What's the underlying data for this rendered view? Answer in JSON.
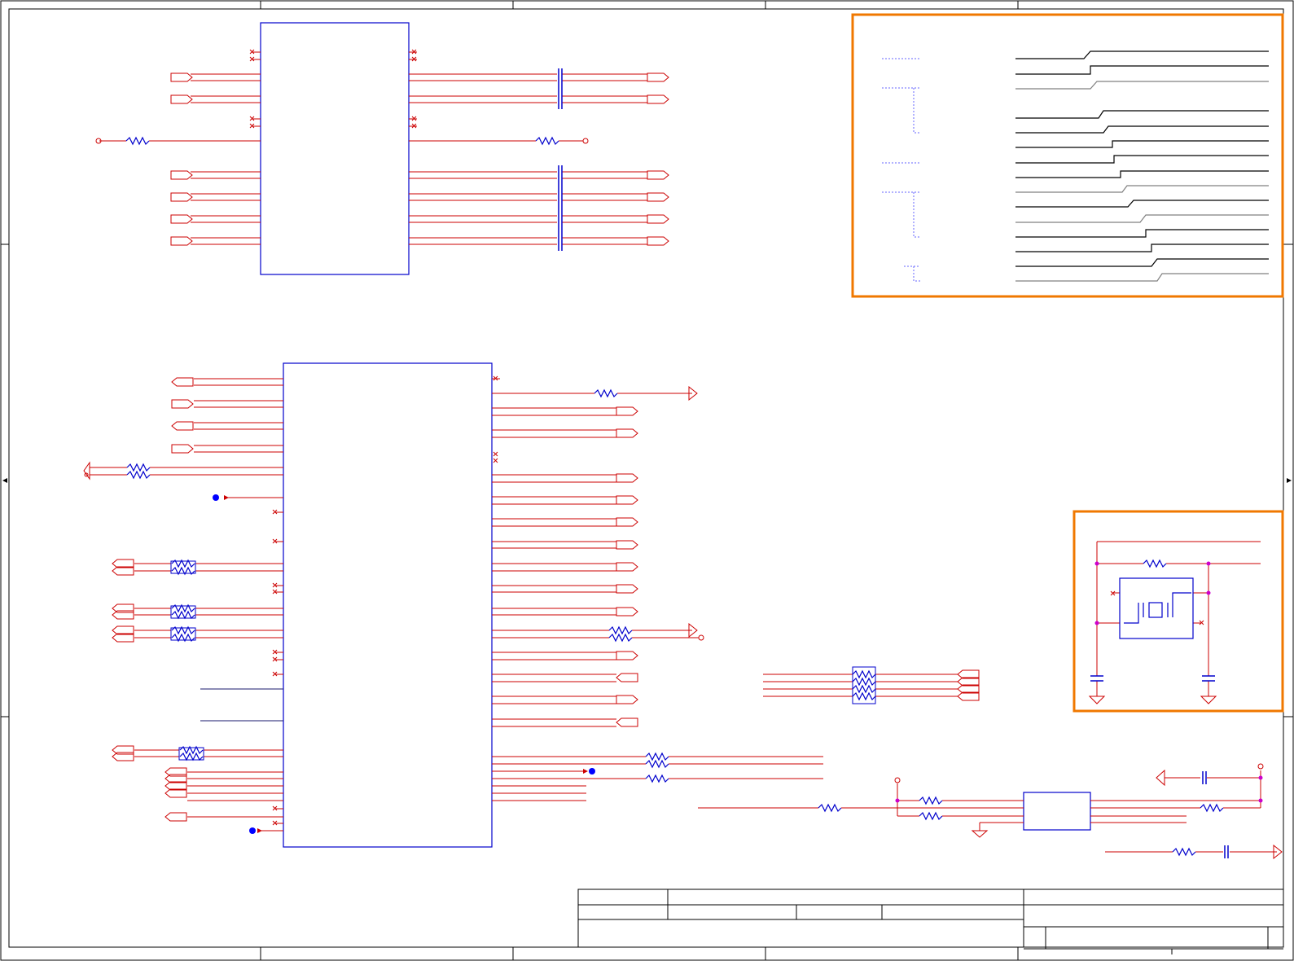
{
  "sheet": {
    "title": "",
    "has_text": false
  },
  "colors": {
    "frame": "#000000",
    "wire_red": "#cc0000",
    "wire_dark": "#1a1a6e",
    "component_blue": "#0000cc",
    "highlight_box": "#f07800",
    "junction": "#cc00cc",
    "port_dot": "#0000ff",
    "grey_line": "#808080"
  },
  "blocks": [
    {
      "id": "ic-top",
      "kind": "ic"
    },
    {
      "id": "ic-main",
      "kind": "ic"
    },
    {
      "id": "ic-small",
      "kind": "ic"
    },
    {
      "id": "crystal-block",
      "kind": "oscillator"
    },
    {
      "id": "resistor-array",
      "kind": "resistor-network"
    }
  ],
  "regions": [
    {
      "id": "bus-breakout-box",
      "kind": "highlight"
    },
    {
      "id": "crystal-box",
      "kind": "highlight"
    },
    {
      "id": "title-block",
      "kind": "table"
    }
  ]
}
